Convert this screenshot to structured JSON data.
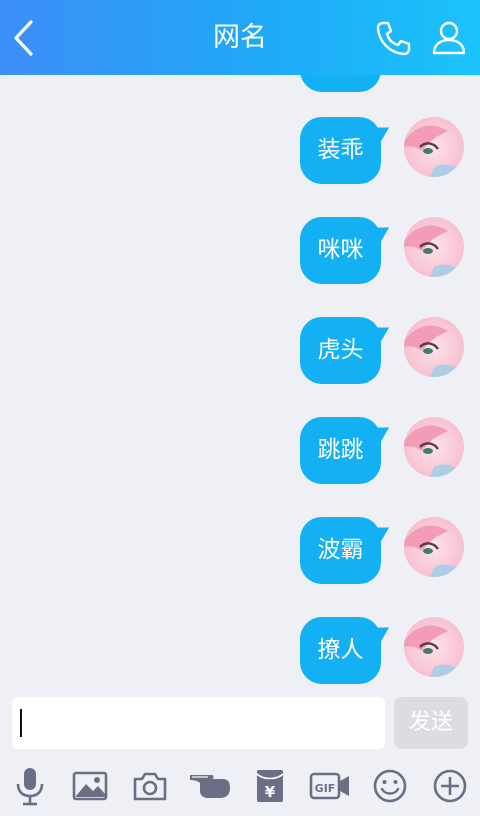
{
  "header": {
    "title": "网名",
    "back_icon": "chevron-left-icon",
    "call_icon": "phone-icon",
    "profile_icon": "person-icon",
    "gradient": [
      "#3d8ef7",
      "#1bc3fb"
    ]
  },
  "messages": [
    {
      "text": "装乖"
    },
    {
      "text": "咪咪"
    },
    {
      "text": "虎头"
    },
    {
      "text": "跳跳"
    },
    {
      "text": "波霸"
    },
    {
      "text": "撩人"
    }
  ],
  "composer": {
    "input_value": "",
    "send_label": "发送"
  },
  "toolbar": {
    "icons": [
      "microphone-icon",
      "image-icon",
      "camera-icon",
      "poke-hand-icon",
      "red-packet-icon",
      "gif-icon",
      "emoji-icon",
      "plus-icon"
    ]
  },
  "colors": {
    "bubble": "#13b1f4",
    "background": "#eef0f6",
    "icon_gray": "#6b6f86"
  }
}
